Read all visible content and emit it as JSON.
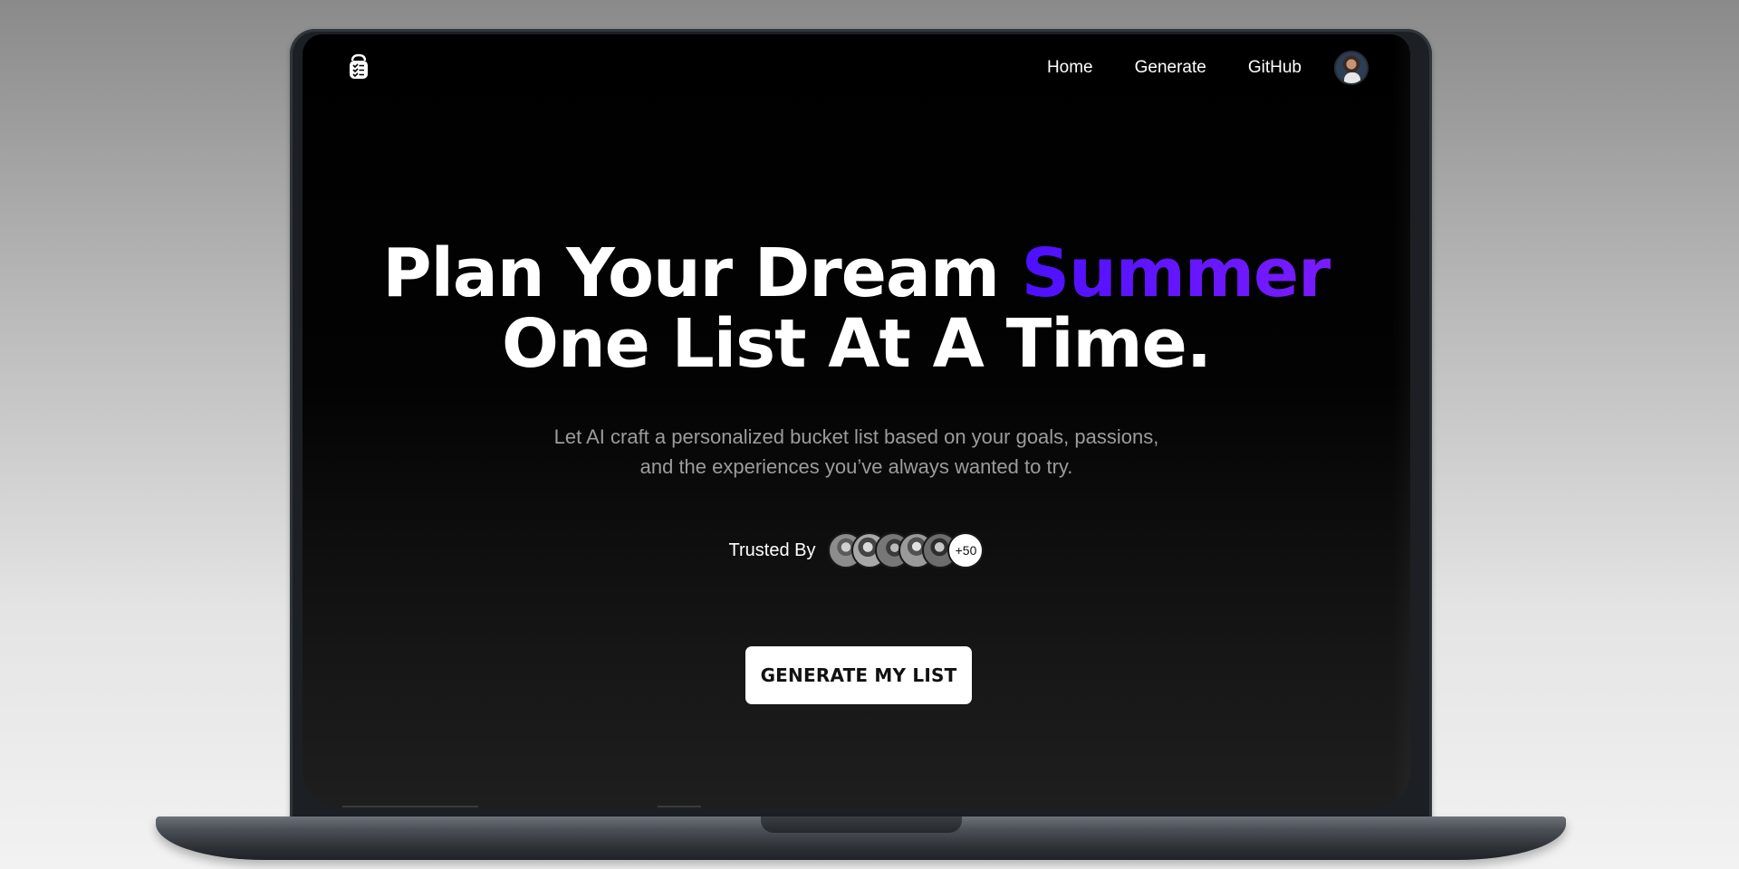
{
  "nav": {
    "logo_icon": "bucket-checklist-icon",
    "items": [
      "Home",
      "Generate",
      "GitHub"
    ],
    "avatar_icon": "user-avatar"
  },
  "hero": {
    "title_part1": "Plan Your Dream ",
    "title_accent": "Summer",
    "title_line2": "One List At A Time.",
    "subtitle_line1": "Let AI craft a personalized bucket list based on your goals, passions,",
    "subtitle_line2": "and the experiences you’ve always wanted to try."
  },
  "trusted": {
    "label": "Trusted By",
    "count": "+50"
  },
  "cta": {
    "label": "GENERATE MY LIST"
  },
  "colors": {
    "accent_start": "#4d10ff",
    "accent_end": "#7a1bff",
    "background": "#000000",
    "subtitle": "#9c9c9c"
  }
}
